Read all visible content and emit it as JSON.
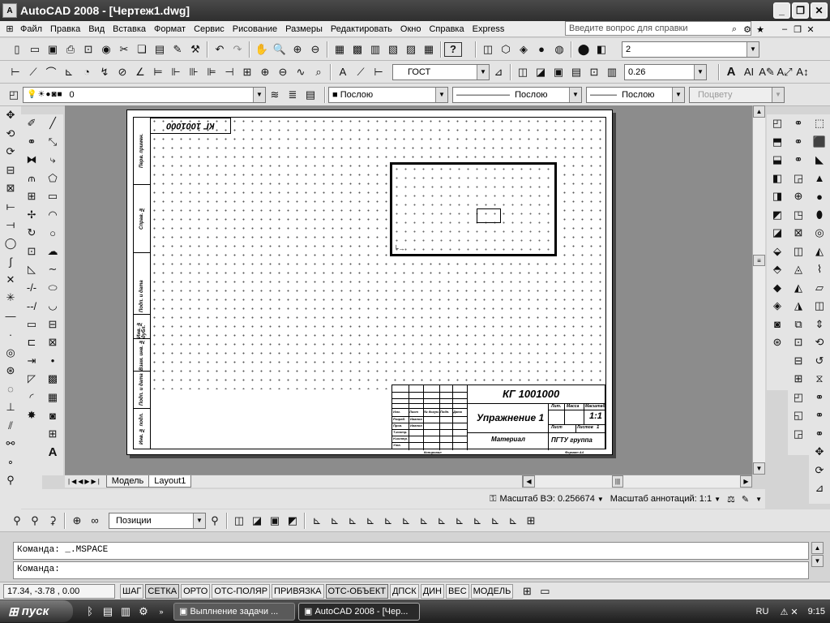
{
  "window": {
    "title": "AutoCAD 2008 - [Чертеж1.dwg]",
    "logo_text": "A"
  },
  "menu": {
    "items": [
      "Файл",
      "Правка",
      "Вид",
      "Вставка",
      "Формат",
      "Сервис",
      "Рисование",
      "Размеры",
      "Редактировать",
      "Окно",
      "Справка",
      "Express"
    ],
    "search_placeholder": "Введите вопрос для справки"
  },
  "styles_toolbar": {
    "text_style": "ГОСТ",
    "dim_value": "2",
    "lineweight_value": "0.26"
  },
  "layers_toolbar": {
    "layer_name": "0",
    "color": "Послою",
    "linetype": "Послою",
    "lineweight": "Послою",
    "plotstyle": "Поцвету"
  },
  "sheet": {
    "code_box": "КГ 1001000",
    "title_code": "КГ 1001000",
    "title_name": "Упражнение 1",
    "scale": "1:1",
    "material": "Материал",
    "org": "ПГТУ группа",
    "sign_row_labels": [
      "Изм.",
      "Лист",
      "№ докум.",
      "Подп.",
      "Дата"
    ],
    "role_labels": [
      "Разраб.",
      "Пров.",
      "Т.контр.",
      "Н.контр.",
      "Утв."
    ],
    "role_names": [
      "Иванов",
      "Иванов"
    ],
    "header_labels": [
      "Лит.",
      "Масса",
      "Масштаб"
    ],
    "sheet_labels": [
      "Лист",
      "Листов"
    ],
    "sheets_total": "1",
    "side_labels": [
      "Перв. примен.",
      "Справ. №",
      "Подп. и дата",
      "Инв. № дубл.",
      "Взам. инв. №",
      "Подп. и дата",
      "Инв. № подл."
    ],
    "footer_left": "Копировал",
    "footer_right": "Формат A4"
  },
  "tabs": [
    "Модель",
    "Layout1"
  ],
  "annotation_bar": {
    "vp_scale_label": "Масштаб ВЭ:",
    "vp_scale_value": "0.256674",
    "annot_scale_label": "Масштаб аннотаций:",
    "annot_scale_value": "1:1"
  },
  "ucs_toolbar": {
    "view_combo": "Позиции"
  },
  "command": {
    "history": "Команда:  _.MSPACE",
    "prompt": "Команда:"
  },
  "status": {
    "coords": "17.34, -3.78 , 0.00",
    "toggles": [
      "ШАГ",
      "СЕТКА",
      "ОРТО",
      "ОТС-ПОЛЯР",
      "ПРИВЯЗКА",
      "ОТС-ОБЪЕКТ",
      "ДПСК",
      "ДИН",
      "ВЕС",
      "МОДЕЛЬ"
    ]
  },
  "taskbar": {
    "start": "пуск",
    "tasks": [
      "Выплнение задачи ...",
      "AutoCAD 2008 - [Чер..."
    ],
    "lang": "RU",
    "time": "9:15"
  }
}
